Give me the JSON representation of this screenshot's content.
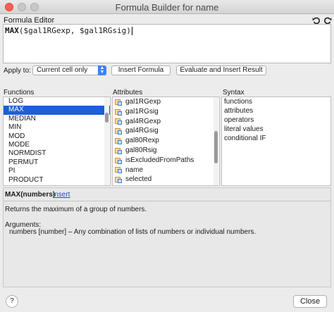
{
  "window": {
    "title": "Formula Builder for name"
  },
  "editor": {
    "label": "Formula Editor",
    "formula_fn": "MAX",
    "formula_args": "($gal1RGexp, $gal1RGsig)",
    "undo_icon": "undo-icon",
    "redo_icon": "redo-icon"
  },
  "apply": {
    "label": "Apply to:",
    "selected": "Current cell only",
    "insert_formula": "Insert Formula",
    "evaluate_insert": "Evaluate and Insert Result"
  },
  "functions": {
    "header": "Functions",
    "items": [
      "LOG",
      "MAX",
      "MEDIAN",
      "MIN",
      "MOD",
      "MODE",
      "NORMDIST",
      "PERMUT",
      "PI",
      "PRODUCT"
    ],
    "selected_index": 1
  },
  "attributes": {
    "header": "Attributes",
    "items": [
      "gal1RGexp",
      "gal1RGsig",
      "gal4RGexp",
      "gal4RGsig",
      "gal80Rexp",
      "gal80Rsig",
      "isExcludedFromPaths",
      "name",
      "selected"
    ]
  },
  "syntax": {
    "header": "Syntax",
    "items": [
      "functions",
      "attributes",
      "operators",
      "literal values",
      "conditional IF"
    ]
  },
  "help": {
    "signature": "MAX(numbers)",
    "insert_link": "insert",
    "description": "Returns the maximum of a group of numbers.",
    "arguments_header": "Arguments:",
    "argument": "numbers [number] – Any combination of lists of numbers or individual numbers."
  },
  "footer": {
    "help_label": "?",
    "close_label": "Close"
  }
}
